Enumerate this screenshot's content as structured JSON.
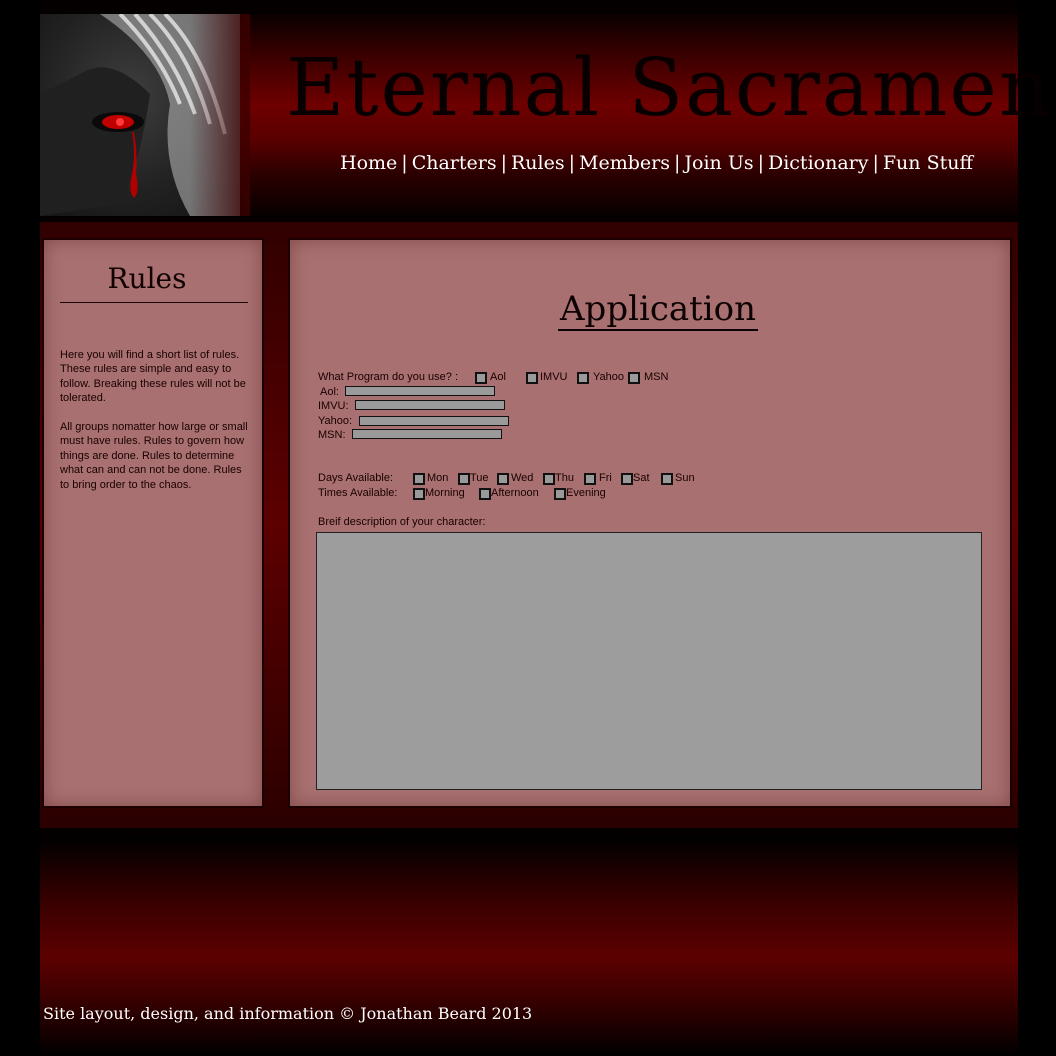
{
  "header": {
    "site_title": "Eternal Sacrament",
    "nav": [
      {
        "label": "Home"
      },
      {
        "label": "Charters"
      },
      {
        "label": "Rules"
      },
      {
        "label": "Members"
      },
      {
        "label": "Join Us"
      },
      {
        "label": "Dictionary"
      },
      {
        "label": "Fun Stuff"
      }
    ],
    "nav_separator": "|"
  },
  "sidebar": {
    "title": "Rules",
    "paragraph1": "Here you will find a short list of rules. These rules are simple and easy to follow. Breaking these rules will not be tolerated.",
    "paragraph2": "All groups nomatter how large or small must have rules. Rules to govern how things are done. Rules to determine what can and can not be done. Rules to bring order to the chaos."
  },
  "application": {
    "title": "Application",
    "program_question": "What Program do you use? :",
    "programs": [
      "Aol",
      "IMVU",
      "Yahoo",
      "MSN"
    ],
    "handles": [
      {
        "label": "Aol:"
      },
      {
        "label": "IMVU:"
      },
      {
        "label": "Yahoo:"
      },
      {
        "label": "MSN:"
      }
    ],
    "days_label": "Days Available:",
    "days": [
      "Mon",
      "Tue",
      "Wed",
      "Thu",
      "Fri",
      "Sat",
      "Sun"
    ],
    "times_label": "Times Available:",
    "times": [
      "Morning",
      "Afternoon",
      "Evening"
    ],
    "description_label": "Breif description of your character:"
  },
  "footer": {
    "copyright": "Site layout, design, and information © Jonathan Beard 2013"
  },
  "colors": {
    "brand_red": "#6e0000",
    "panel": "#a87070",
    "input_gray": "#9a9a9a"
  }
}
